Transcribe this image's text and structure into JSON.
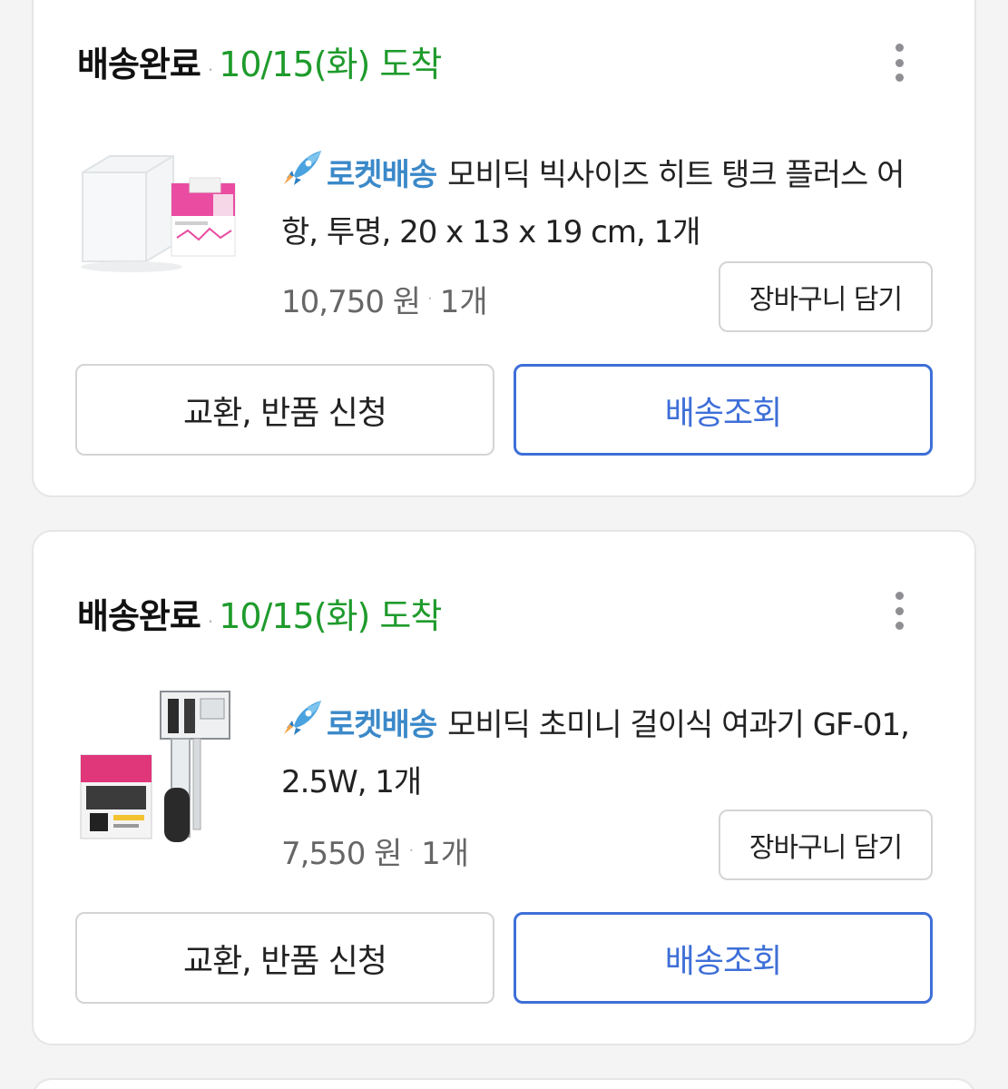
{
  "orders": [
    {
      "status": "배송완료",
      "separator": "·",
      "arrival": "10/15(화) 도착",
      "badge": "로켓배송",
      "product_name": "모비딕 빅사이즈 히트 탱크 플러스 어항, 투명, 20 x 13 x 19 cm, 1개",
      "price": "10,750 원",
      "price_separator": "·",
      "quantity": "1개",
      "cart_button": "장바구니 담기",
      "exchange_button": "교환, 반품 신청",
      "tracking_button": "배송조회"
    },
    {
      "status": "배송완료",
      "separator": "·",
      "arrival": "10/15(화) 도착",
      "badge": "로켓배송",
      "product_name": "모비딕 초미니 걸이식 여과기 GF-01, 2.5W, 1개",
      "price": "7,550 원",
      "price_separator": "·",
      "quantity": "1개",
      "cart_button": "장바구니 담기",
      "exchange_button": "교환, 반품 신청",
      "tracking_button": "배송조회"
    }
  ],
  "colors": {
    "arrival_green": "#1f9b2c",
    "rocket_blue": "#3b89c9",
    "primary_blue": "#3e6fd8"
  },
  "icons": [
    "rocket-icon",
    "more-vertical-icon"
  ]
}
